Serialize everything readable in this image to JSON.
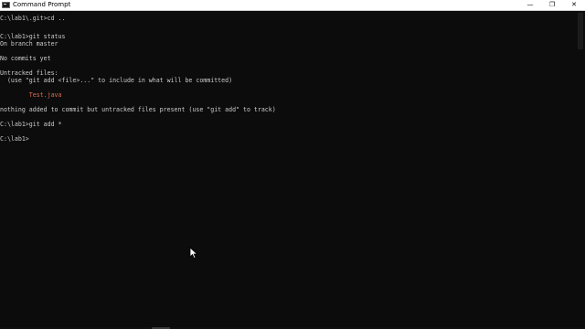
{
  "window": {
    "title": "Command Prompt",
    "controls": {
      "minimize": "—",
      "maximize": "❐",
      "close": "✕"
    }
  },
  "console": {
    "lines": [
      "C:\\lab1\\.git>cd ..",
      "",
      "C:\\lab1>git status",
      "On branch master",
      "",
      "No commits yet",
      "",
      "Untracked files:",
      "  (use \"git add <file>...\" to include in what will be committed)",
      "",
      "        Test.java",
      "",
      "nothing added to commit but untracked files present (use \"git add\" to track)",
      "",
      "C:\\lab1>git add *",
      "",
      "C:\\lab1>"
    ]
  },
  "colors": {
    "background": "#0c0c0c",
    "text": "#cccccc",
    "untracked": "#e06c52"
  }
}
